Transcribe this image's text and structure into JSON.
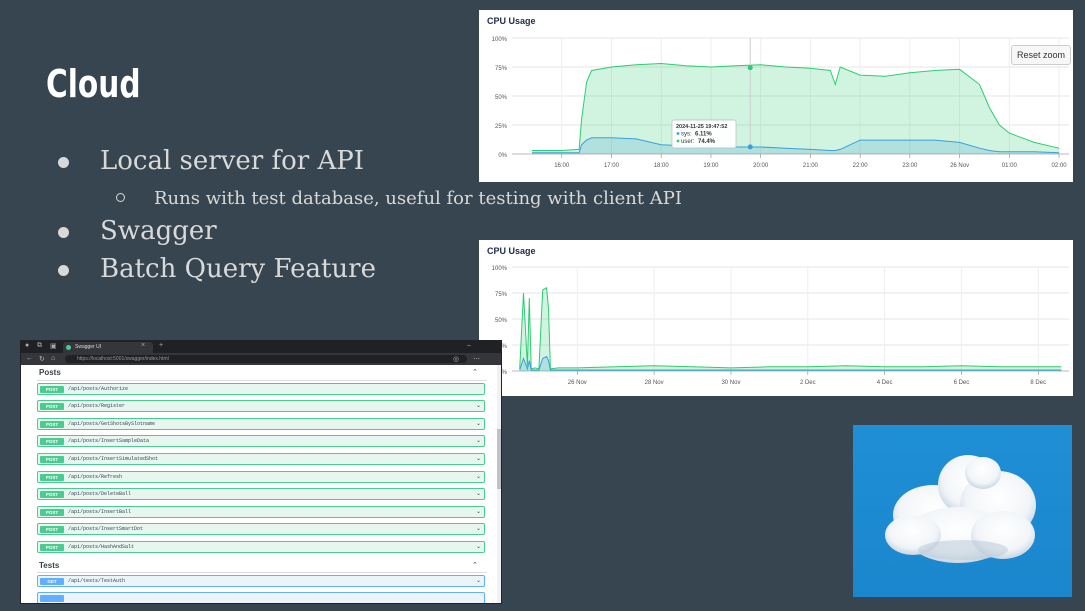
{
  "slide": {
    "title": "Cloud",
    "bullets": [
      {
        "text": "Local server for API",
        "sub": [
          "Runs with test database, useful for testing with client API"
        ]
      },
      {
        "text": "Swagger",
        "sub": []
      },
      {
        "text": "Batch Query Feature",
        "sub": []
      }
    ]
  },
  "colors": {
    "background": "#36454f",
    "post_green": "#49cc90",
    "get_blue": "#61affe",
    "user_series": "#2ecc71",
    "sys_series": "#3aa0d8"
  },
  "chart_data": [
    {
      "type": "area",
      "title": "CPU Usage",
      "reset_label": "Reset zoom",
      "y_ticks": [
        "100%",
        "75%",
        "50%",
        "25%",
        "0%"
      ],
      "ylim": [
        0,
        100
      ],
      "x_ticks": [
        "16:00",
        "17:00",
        "18:00",
        "19:00",
        "20:00",
        "21:00",
        "22:00",
        "23:00",
        "26 Nov",
        "01:00",
        "02:00"
      ],
      "x": [
        15.4,
        16.0,
        16.35,
        16.4,
        16.5,
        16.6,
        17.0,
        17.5,
        18.0,
        18.5,
        19.0,
        19.5,
        20.0,
        20.5,
        21.0,
        21.4,
        21.5,
        21.6,
        22.0,
        22.5,
        23.0,
        23.5,
        24.0,
        24.4,
        24.6,
        24.8,
        25.0,
        25.5,
        26.0
      ],
      "series": [
        {
          "name": "user",
          "values": [
            3,
            3,
            4,
            30,
            62,
            72,
            75,
            77,
            78,
            76,
            75,
            76,
            77,
            75,
            74,
            72,
            60,
            75,
            68,
            67,
            70,
            72,
            73,
            60,
            40,
            25,
            18,
            10,
            5
          ]
        },
        {
          "name": "sys",
          "values": [
            1,
            1,
            1,
            8,
            12,
            14,
            14,
            13,
            8,
            7,
            6,
            6,
            6,
            5,
            4,
            3,
            3,
            4,
            12,
            12,
            12,
            12,
            10,
            5,
            3,
            2,
            2,
            2,
            1
          ]
        }
      ],
      "tooltip": {
        "time": "2024-11-25 19:47:52",
        "sys_label": "sys:",
        "sys_value": "6.11%",
        "user_label": "user:",
        "user_value": "74.4%"
      }
    },
    {
      "type": "line",
      "title": "CPU Usage",
      "y_ticks": [
        "100%",
        "75%",
        "50%",
        "25%",
        "0%"
      ],
      "ylim": [
        0,
        100
      ],
      "x_ticks": [
        "26 Nov",
        "28 Nov",
        "30 Nov",
        "2 Dec",
        "4 Dec",
        "6 Dec",
        "8 Dec"
      ],
      "x": [
        24.5,
        24.6,
        24.7,
        24.75,
        24.8,
        24.9,
        25.0,
        25.1,
        25.2,
        25.25,
        25.3,
        25.5,
        26.0,
        27.0,
        28.0,
        29.0,
        30.0,
        31.0,
        32.0,
        33.0,
        34.0,
        35.0,
        36.0,
        37.0,
        38.0,
        38.6
      ],
      "series": [
        {
          "name": "user",
          "values": [
            2,
            75,
            5,
            70,
            2,
            3,
            2,
            78,
            80,
            60,
            2,
            3,
            3,
            4,
            5,
            4,
            3,
            4,
            4,
            5,
            4,
            4,
            5,
            4,
            4,
            4
          ]
        },
        {
          "name": "sys",
          "values": [
            1,
            12,
            2,
            10,
            1,
            1,
            1,
            12,
            14,
            10,
            1,
            1,
            1,
            1,
            1,
            1,
            1,
            1,
            1,
            1,
            1,
            1,
            1,
            1,
            1,
            1
          ]
        }
      ]
    }
  ],
  "browser": {
    "tab_title": "Swagger UI",
    "url": "https://localhost:5001/swagger/index.html",
    "sections": [
      {
        "name": "Posts",
        "ops": [
          {
            "method": "POST",
            "path": "/api/posts/Authorize"
          },
          {
            "method": "POST",
            "path": "/api/posts/Register"
          },
          {
            "method": "POST",
            "path": "/api/posts/GetShotsBySlotname"
          },
          {
            "method": "POST",
            "path": "/api/posts/InsertSampleData"
          },
          {
            "method": "POST",
            "path": "/api/posts/InsertSimulatedShot"
          },
          {
            "method": "POST",
            "path": "/api/posts/Refresh"
          },
          {
            "method": "POST",
            "path": "/api/posts/DeleteBall"
          },
          {
            "method": "POST",
            "path": "/api/posts/InsertBall"
          },
          {
            "method": "POST",
            "path": "/api/posts/InsertSmartDot"
          },
          {
            "method": "POST",
            "path": "/api/posts/HashAndSalt"
          }
        ]
      },
      {
        "name": "Tests",
        "ops": [
          {
            "method": "GET",
            "path": "/api/tests/TestAuth"
          }
        ]
      }
    ]
  },
  "image": {
    "icon": "cloud-icon"
  }
}
